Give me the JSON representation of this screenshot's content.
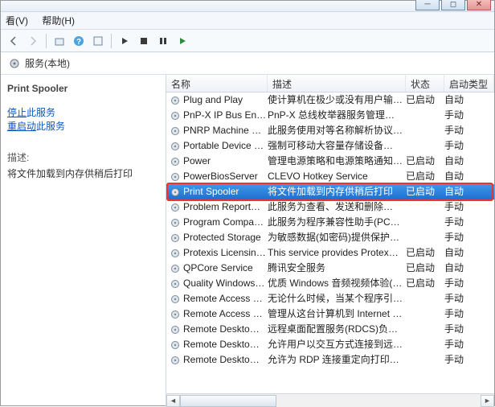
{
  "menubar": {
    "view": "看(V)",
    "help": "帮助(H)"
  },
  "tree": {
    "label": "服务(本地)"
  },
  "left": {
    "title": "Print Spooler",
    "stop_prefix": "停止",
    "stop_suffix": "此服务",
    "restart_prefix": "重启动",
    "restart_suffix": "此服务",
    "desc_label": "描述:",
    "desc_text": "将文件加载到内存供稍后打印"
  },
  "columns": {
    "name": "名称",
    "desc": "描述",
    "state": "状态",
    "start": "启动类型"
  },
  "selected_name": "Print Spooler",
  "services": [
    {
      "name": "Plug and Play",
      "desc": "使计算机在极少或没有用户输…",
      "state": "已启动",
      "start": "自动"
    },
    {
      "name": "PnP-X IP Bus En…",
      "desc": "PnP-X 总线枚举器服务管理虚…",
      "state": "",
      "start": "手动"
    },
    {
      "name": "PNRP Machine …",
      "desc": "此服务使用对等名称解析协议…",
      "state": "",
      "start": "手动"
    },
    {
      "name": "Portable Device …",
      "desc": "强制可移动大容量存储设备…",
      "state": "",
      "start": "手动"
    },
    {
      "name": "Power",
      "desc": "管理电源策略和电源策略通知…",
      "state": "已启动",
      "start": "自动"
    },
    {
      "name": "PowerBiosServer",
      "desc": "CLEVO Hotkey Service",
      "state": "已启动",
      "start": "自动"
    },
    {
      "name": "Print Spooler",
      "desc": "将文件加载到内存供稍后打印",
      "state": "已启动",
      "start": "自动"
    },
    {
      "name": "Problem Report…",
      "desc": "此服务为查看、发送和删除…",
      "state": "",
      "start": "手动"
    },
    {
      "name": "Program Compa…",
      "desc": "此服务为程序兼容性助手(PCA)…",
      "state": "",
      "start": "手动"
    },
    {
      "name": "Protected Storage",
      "desc": "为敏感数据(如密码)提供保护…",
      "state": "",
      "start": "手动"
    },
    {
      "name": "Protexis Licensin…",
      "desc": "This service provides Protex…",
      "state": "已启动",
      "start": "自动"
    },
    {
      "name": "QPCore Service",
      "desc": "腾讯安全服务",
      "state": "已启动",
      "start": "自动"
    },
    {
      "name": "Quality Windows…",
      "desc": "优质 Windows 音频视频体验(…",
      "state": "已启动",
      "start": "手动"
    },
    {
      "name": "Remote Access …",
      "desc": "无论什么时候，当某个程序引…",
      "state": "",
      "start": "手动"
    },
    {
      "name": "Remote Access …",
      "desc": "管理从这台计算机到 Internet …",
      "state": "",
      "start": "手动"
    },
    {
      "name": "Remote Deskto…",
      "desc": "远程桌面配置服务(RDCS)负责…",
      "state": "",
      "start": "手动"
    },
    {
      "name": "Remote Deskto…",
      "desc": "允许用户以交互方式连接到远…",
      "state": "",
      "start": "手动"
    },
    {
      "name": "Remote Deskto…",
      "desc": "允许为 RDP 连接重定向打印…",
      "state": "",
      "start": "手动"
    }
  ]
}
